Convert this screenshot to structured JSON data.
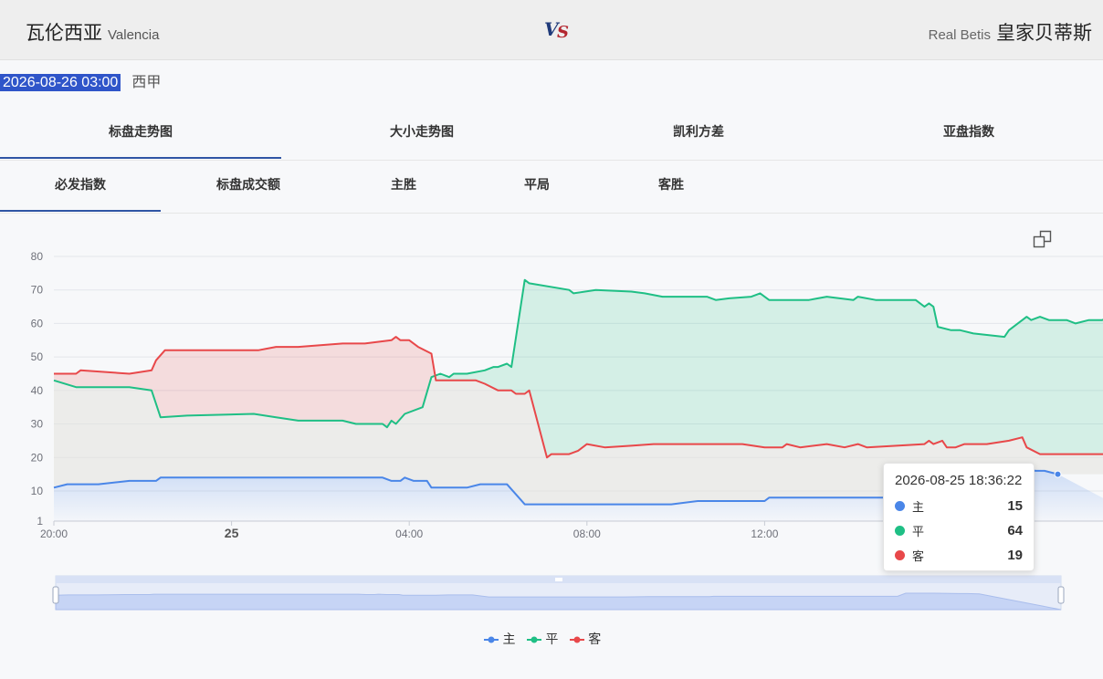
{
  "match": {
    "home_cn": "瓦伦西亚",
    "home_en": "Valencia",
    "vs": {
      "v": "V",
      "s": "S"
    },
    "away_en": "Real Betis",
    "away_cn": "皇家贝蒂斯",
    "datetime": "2026-08-26 03:00",
    "league": "西甲"
  },
  "tabs": [
    "标盘走势图",
    "大小走势图",
    "凯利方差",
    "亚盘指数"
  ],
  "subtabs": [
    "必发指数",
    "标盘成交额",
    "主胜",
    "平局",
    "客胜"
  ],
  "icons": {
    "restore": "restore-icon"
  },
  "colors": {
    "home": "#4a86e8",
    "draw": "#1fbf85",
    "away": "#e8484a",
    "tab_active": "#2f55a4"
  },
  "tooltip": {
    "title": "2026-08-25 18:36:22",
    "rows": [
      {
        "name": "主",
        "value": "15"
      },
      {
        "name": "平",
        "value": "64"
      },
      {
        "name": "客",
        "value": "19"
      }
    ]
  },
  "chart_data": {
    "type": "line",
    "x_range": [
      "2026-08-24 20:00",
      "2026-08-25 18:36"
    ],
    "x_ticks": [
      "20:00",
      "25",
      "04:00",
      "08:00",
      "12:00"
    ],
    "y_ticks": [
      "1",
      "10",
      "20",
      "30",
      "40",
      "50",
      "60",
      "70",
      "80"
    ],
    "ylim": [
      1,
      80
    ],
    "legend_position": "bottom",
    "grid": true,
    "series": [
      {
        "name": "主",
        "points": [
          [
            0,
            11
          ],
          [
            0.3,
            12
          ],
          [
            1,
            12
          ],
          [
            1.7,
            13
          ],
          [
            2.3,
            13
          ],
          [
            2.4,
            14
          ],
          [
            4,
            14
          ],
          [
            6,
            14
          ],
          [
            7.4,
            14
          ],
          [
            7.6,
            13
          ],
          [
            7.8,
            13
          ],
          [
            7.9,
            14
          ],
          [
            8.1,
            13
          ],
          [
            8.2,
            13
          ],
          [
            8.4,
            13
          ],
          [
            8.5,
            11
          ],
          [
            9,
            11
          ],
          [
            9.3,
            11
          ],
          [
            9.6,
            12
          ],
          [
            10,
            12
          ],
          [
            10.2,
            12
          ],
          [
            10.6,
            6
          ],
          [
            11,
            6
          ],
          [
            13,
            6
          ],
          [
            13.9,
            6
          ],
          [
            14.5,
            7
          ],
          [
            15.5,
            7
          ],
          [
            16,
            7
          ],
          [
            16.1,
            8
          ],
          [
            17,
            8
          ],
          [
            19,
            8
          ],
          [
            20.6,
            8
          ],
          [
            20.8,
            17
          ],
          [
            21,
            17
          ],
          [
            21.5,
            17
          ],
          [
            22.1,
            16
          ],
          [
            22.3,
            16
          ],
          [
            22.6,
            15
          ]
        ]
      },
      {
        "name": "平",
        "points": [
          [
            0,
            43
          ],
          [
            0.5,
            41
          ],
          [
            1.7,
            41
          ],
          [
            2.2,
            40
          ],
          [
            2.4,
            32
          ],
          [
            3,
            32.5
          ],
          [
            4.5,
            33
          ],
          [
            5,
            32
          ],
          [
            5.5,
            31
          ],
          [
            6.5,
            31
          ],
          [
            6.8,
            30
          ],
          [
            7.2,
            30
          ],
          [
            7.4,
            30
          ],
          [
            7.5,
            29
          ],
          [
            7.6,
            31
          ],
          [
            7.7,
            30
          ],
          [
            7.9,
            33
          ],
          [
            8.3,
            35
          ],
          [
            8.5,
            44
          ],
          [
            8.7,
            45
          ],
          [
            8.9,
            44
          ],
          [
            9,
            45
          ],
          [
            9.3,
            45
          ],
          [
            9.7,
            46
          ],
          [
            9.9,
            47
          ],
          [
            10,
            47
          ],
          [
            10.2,
            48
          ],
          [
            10.3,
            47
          ],
          [
            10.6,
            73
          ],
          [
            10.7,
            72
          ],
          [
            11.6,
            70
          ],
          [
            11.7,
            69
          ],
          [
            12.2,
            70
          ],
          [
            13,
            69.5
          ],
          [
            13.3,
            69
          ],
          [
            13.7,
            68
          ],
          [
            14.2,
            68
          ],
          [
            14.7,
            68
          ],
          [
            14.9,
            67
          ],
          [
            15.2,
            67.5
          ],
          [
            15.7,
            68
          ],
          [
            15.9,
            69
          ],
          [
            16.1,
            67
          ],
          [
            17,
            67
          ],
          [
            17.2,
            67.5
          ],
          [
            17.4,
            68
          ],
          [
            18,
            67
          ],
          [
            18.1,
            68
          ],
          [
            18.5,
            67
          ],
          [
            19.4,
            67
          ],
          [
            19.6,
            65
          ],
          [
            19.7,
            66
          ],
          [
            19.8,
            65
          ],
          [
            19.9,
            59
          ],
          [
            20.2,
            58
          ],
          [
            20.4,
            58
          ],
          [
            20.7,
            57
          ],
          [
            21.4,
            56
          ],
          [
            21.5,
            58
          ],
          [
            21.9,
            62
          ],
          [
            22,
            61
          ],
          [
            22.2,
            62
          ],
          [
            22.4,
            61
          ],
          [
            22.8,
            61
          ],
          [
            23,
            60
          ],
          [
            23.3,
            61
          ],
          [
            23.6,
            61
          ],
          [
            23.8,
            62
          ],
          [
            24.3,
            64
          ],
          [
            24.6,
            64
          ]
        ]
      },
      {
        "name": "客",
        "points": [
          [
            0,
            45
          ],
          [
            0.5,
            45
          ],
          [
            0.6,
            46
          ],
          [
            1.7,
            45
          ],
          [
            2.2,
            46
          ],
          [
            2.3,
            49
          ],
          [
            2.5,
            52
          ],
          [
            3,
            52
          ],
          [
            4.6,
            52
          ],
          [
            5,
            53
          ],
          [
            5.5,
            53
          ],
          [
            6.5,
            54
          ],
          [
            7,
            54
          ],
          [
            7.6,
            55
          ],
          [
            7.7,
            56
          ],
          [
            7.8,
            55
          ],
          [
            8,
            55
          ],
          [
            8.2,
            53
          ],
          [
            8.5,
            51
          ],
          [
            8.6,
            43
          ],
          [
            9,
            43
          ],
          [
            9.5,
            43
          ],
          [
            9.7,
            42
          ],
          [
            10,
            40
          ],
          [
            10.3,
            40
          ],
          [
            10.4,
            39
          ],
          [
            10.6,
            39
          ],
          [
            10.7,
            40
          ],
          [
            11.1,
            20
          ],
          [
            11.2,
            21
          ],
          [
            11.6,
            21
          ],
          [
            11.8,
            22
          ],
          [
            12,
            24
          ],
          [
            12.4,
            23
          ],
          [
            13,
            23.5
          ],
          [
            13.5,
            24
          ],
          [
            14,
            24
          ],
          [
            15.5,
            24
          ],
          [
            16,
            23
          ],
          [
            16.4,
            23
          ],
          [
            16.5,
            24
          ],
          [
            16.8,
            23
          ],
          [
            17.4,
            24
          ],
          [
            17.8,
            23
          ],
          [
            18.1,
            24
          ],
          [
            18.3,
            23
          ],
          [
            19.6,
            24
          ],
          [
            19.7,
            25
          ],
          [
            19.8,
            24
          ],
          [
            20,
            25
          ],
          [
            20.1,
            23
          ],
          [
            20.3,
            23
          ],
          [
            20.5,
            24
          ],
          [
            21,
            24
          ],
          [
            21.5,
            25
          ],
          [
            21.8,
            26
          ],
          [
            21.9,
            23
          ],
          [
            22.2,
            21
          ],
          [
            22.8,
            21
          ],
          [
            23.3,
            21
          ],
          [
            23.8,
            21
          ],
          [
            24.3,
            20
          ],
          [
            24.6,
            19
          ]
        ]
      }
    ]
  }
}
